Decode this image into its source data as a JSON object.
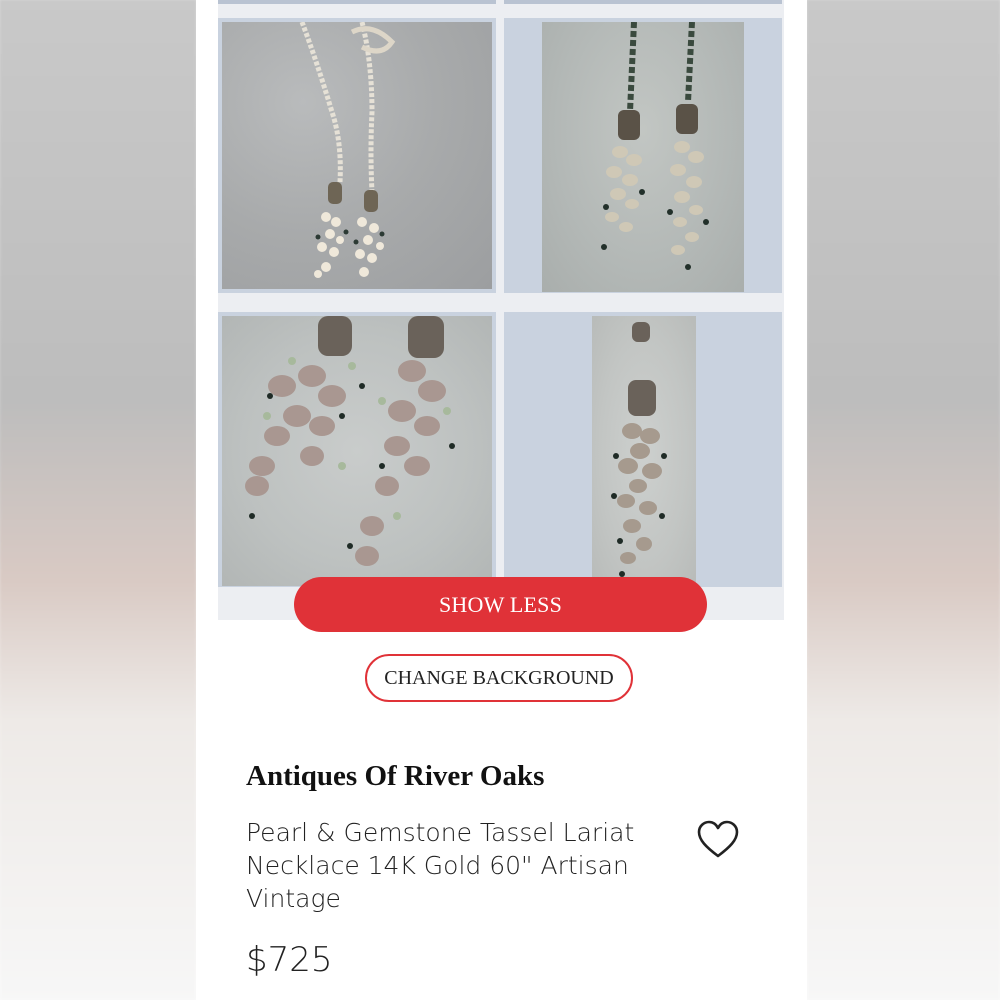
{
  "buttons": {
    "show_less": "SHOW LESS",
    "change_background": "CHANGE BACKGROUND"
  },
  "listing": {
    "seller": "Antiques Of River Oaks",
    "title": "Pearl & Gemstone Tassel Lariat Necklace 14K Gold 60\" Artisan Vintage",
    "price": "$725"
  },
  "icons": {
    "favorite": "heart-outline-icon"
  },
  "colors": {
    "accent": "#e03238",
    "tile_background": "#c9d2df"
  }
}
